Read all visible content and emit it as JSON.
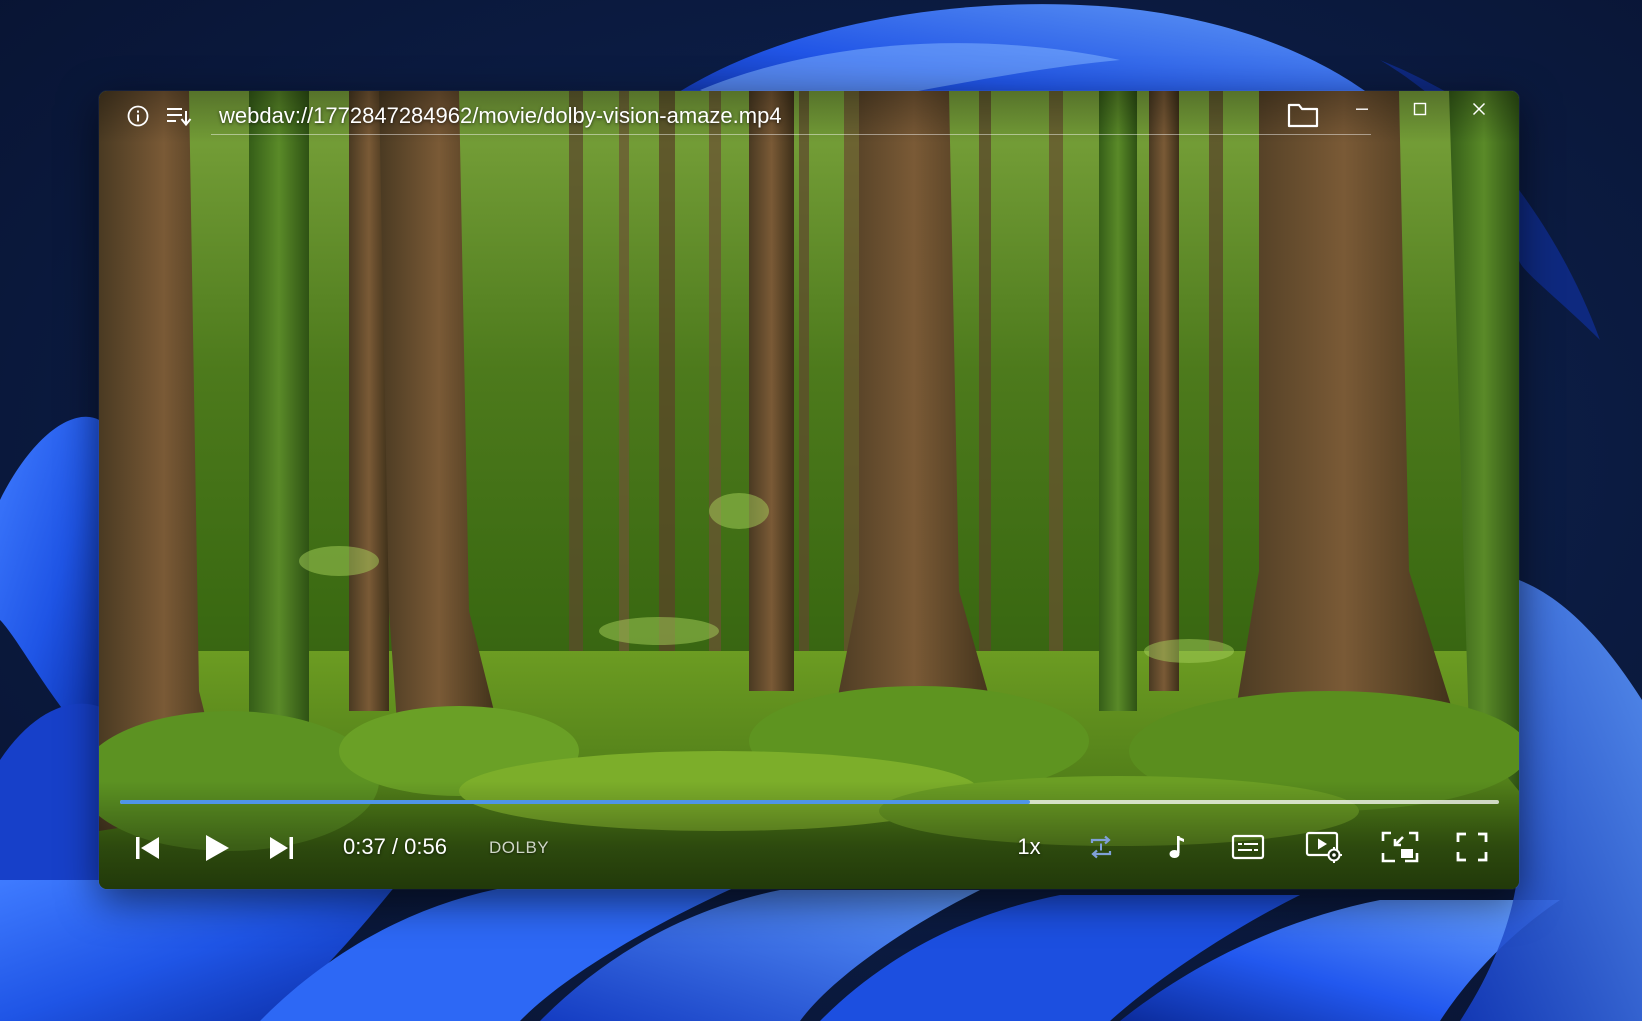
{
  "window": {
    "file_path": "webdav://1772847284962/movie/dolby-vision-amaze.mp4"
  },
  "icons": {
    "info": "info-icon",
    "playlist": "playlist-icon",
    "folder": "folder-icon",
    "minimize": "minimize-icon",
    "maximize": "maximize-icon",
    "close": "close-icon",
    "previous": "skip-previous-icon",
    "play": "play-icon",
    "next": "skip-next-icon",
    "repeat": "repeat-icon",
    "audio_track": "music-note-icon",
    "subtitles": "subtitles-icon",
    "video_settings": "video-settings-icon",
    "mini_player": "mini-player-icon",
    "fullscreen": "fullscreen-icon"
  },
  "playback": {
    "time": "0:37 / 0:56",
    "progress_fraction": 0.66,
    "hdr_badge": "DOLBY",
    "speed": "1x"
  },
  "colors": {
    "progress_fill": "#4f95e8",
    "progress_track": "#ffffff"
  }
}
